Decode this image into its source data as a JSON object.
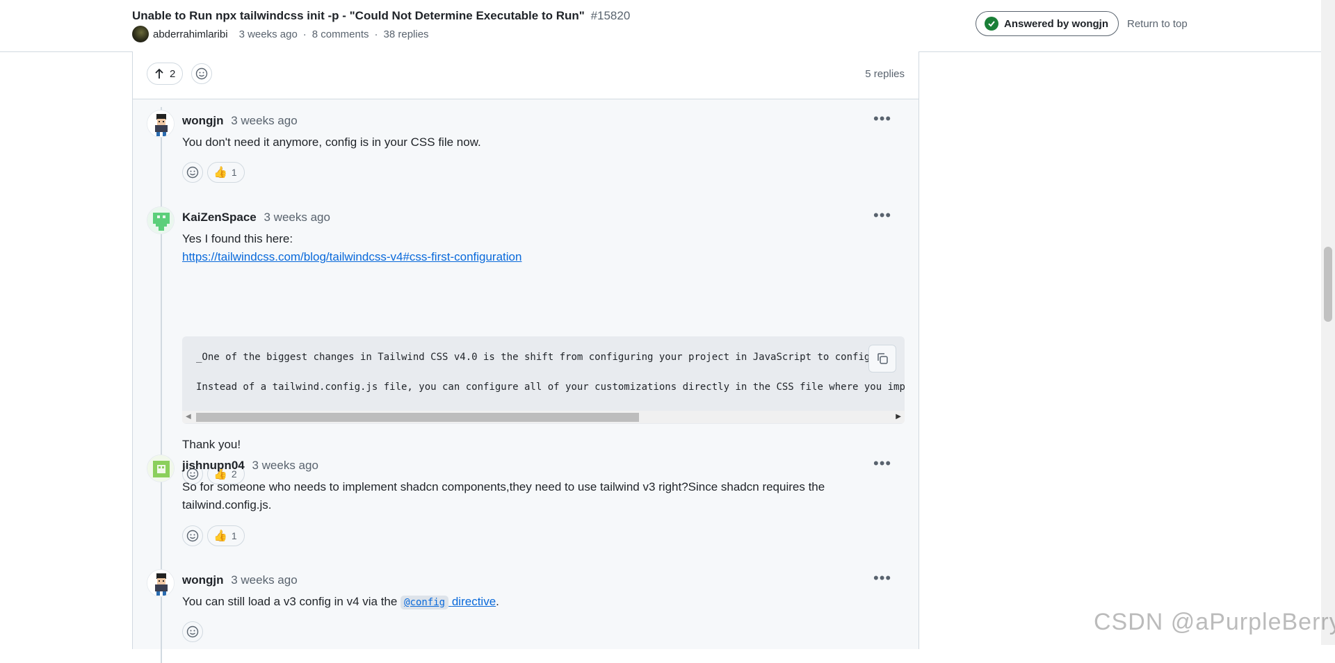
{
  "header": {
    "title": "Unable to Run npx tailwindcss init -p - \"Could Not Determine Executable to Run\"",
    "number": "#15820",
    "author": "abderrahimlaribi",
    "time": "3 weeks ago",
    "comments": "8 comments",
    "replies": "38 replies",
    "separator": "·",
    "answered_label": "Answered by wongjn",
    "return_top": "Return to top"
  },
  "thread": {
    "upvotes": "2",
    "replies_count": "5 replies"
  },
  "comments": [
    {
      "author": "wongjn",
      "time": "3 weeks ago",
      "body": "You don't need it anymore, config is in your CSS file now.",
      "thumbs": "1"
    },
    {
      "author": "KaiZenSpace",
      "time": "3 weeks ago",
      "body_intro": "Yes I found this here:",
      "link": "https://tailwindcss.com/blog/tailwindcss-v4#css-first-configuration",
      "code_line_1": "_One of the biggest changes in Tailwind CSS v4.0 is the shift from configuring your project in JavaScript to configurin",
      "code_line_1_tail": "i",
      "code_line_2": "Instead of a tailwind.config.js file, you can configure all of your customizations directly in the CSS file where you import",
      "body_outro": "Thank you!",
      "thumbs": "2"
    },
    {
      "author": "jishnupn04",
      "time": "3 weeks ago",
      "body_line_1": "So for someone who needs to implement shadcn components,they need to use tailwind v3 right?Since shadcn requires the",
      "body_line_2": "tailwind.config.js.",
      "thumbs": "1"
    },
    {
      "author": "wongjn",
      "time": "3 weeks ago",
      "body_prefix": "You can still load a v3 config in v4 via the",
      "body_code": "@config",
      "body_link": "directive",
      "body_suffix": "."
    }
  ],
  "watermark": "CSDN @aPurpleBerry",
  "colors": {
    "link": "#0969da",
    "answered_green": "#1a7f37",
    "muted": "#59636e",
    "border": "#d1d9e0"
  }
}
